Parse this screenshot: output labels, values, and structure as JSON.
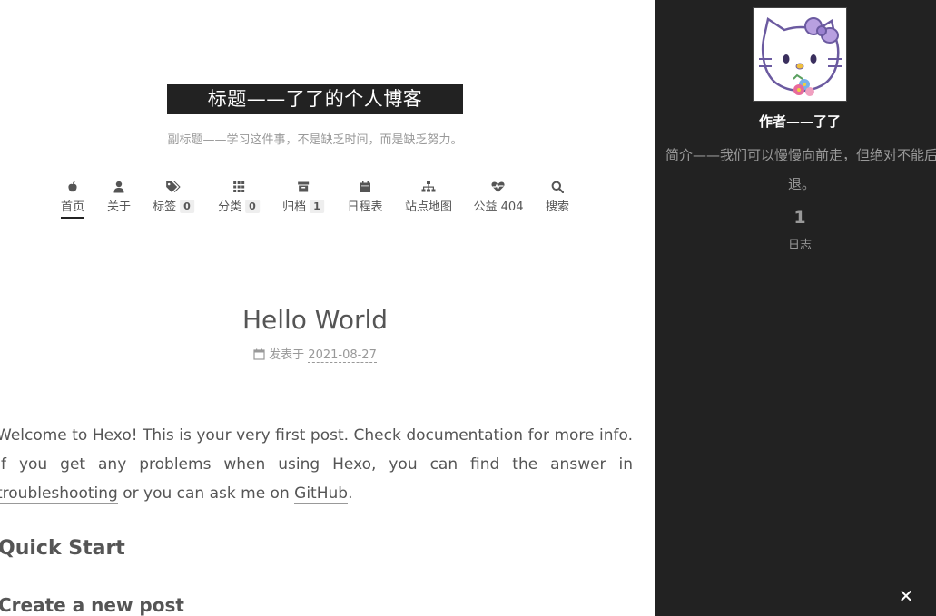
{
  "site": {
    "title": "标题——了了的个人博客",
    "subtitle": "副标题——学习这件事，不是缺乏时间，而是缺乏努力。"
  },
  "menu": {
    "items": [
      {
        "label": "首页",
        "icon": "apple-icon",
        "badge": null,
        "active": true
      },
      {
        "label": "关于",
        "icon": "user-icon",
        "badge": null
      },
      {
        "label": "标签",
        "icon": "tags-icon",
        "badge": "0"
      },
      {
        "label": "分类",
        "icon": "grid-icon",
        "badge": "0"
      },
      {
        "label": "归档",
        "icon": "archive-icon",
        "badge": "1"
      },
      {
        "label": "日程表",
        "icon": "calendar-icon",
        "badge": null
      },
      {
        "label": "站点地图",
        "icon": "sitemap-icon",
        "badge": null
      },
      {
        "label": "公益 404",
        "icon": "heartbeat-icon",
        "badge": null
      },
      {
        "label": "搜索",
        "icon": "search-icon",
        "badge": null
      }
    ]
  },
  "post": {
    "title": "Hello World",
    "meta_prefix": "发表于",
    "date": "2021-08-27",
    "body": {
      "t1": "Welcome to ",
      "link_hexo": "Hexo",
      "t2": "! This is your very first post. Check ",
      "link_docs": "documentation",
      "t3": " for more info. If you get any problems when using Hexo, you can find the answer in ",
      "link_troubleshooting": "troubleshooting",
      "t4": " or you can ask me on ",
      "link_github": "GitHub",
      "t5": "."
    },
    "h2": "Quick Start",
    "h3": "Create a new post"
  },
  "sidebar": {
    "author": "作者——了了",
    "description": "简介——我们可以慢慢向前走，但绝对不能后退。",
    "posts_count": "1",
    "posts_label": "日志",
    "close_icon": "close-icon"
  },
  "colors": {
    "sidebar_bg": "#222222",
    "brand_bg": "#222222",
    "text": "#555555",
    "muted": "#999999"
  }
}
